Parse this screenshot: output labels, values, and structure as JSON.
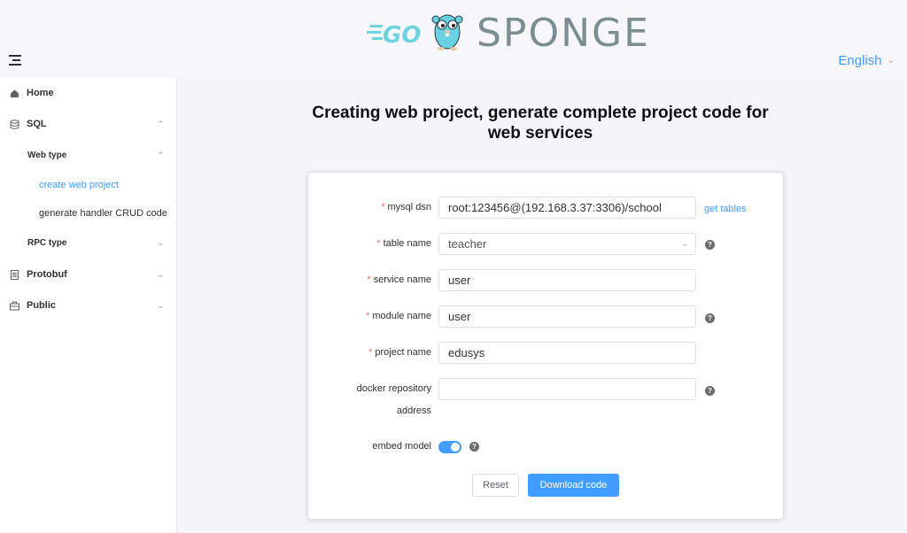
{
  "header": {
    "logo_go": "GO",
    "logo_word": "SPONGE",
    "language": "English"
  },
  "sidebar": {
    "home": "Home",
    "sql": "SQL",
    "web_type": "Web type",
    "create_web_project": "create web project",
    "generate_handler": "generate handler CRUD code",
    "rpc_type": "RPC type",
    "protobuf": "Protobuf",
    "public": "Public"
  },
  "page": {
    "title": "Creating web project, generate complete project code for web services"
  },
  "form": {
    "mysql_dsn_label": "mysql dsn",
    "mysql_dsn_value": "root:123456@(192.168.3.37:3306)/school",
    "get_tables": "get tables",
    "table_name_label": "table name",
    "table_name_value": "teacher",
    "service_name_label": "service name",
    "service_name_value": "user",
    "module_name_label": "module name",
    "module_name_value": "user",
    "project_name_label": "project name",
    "project_name_value": "edusys",
    "docker_label_line1": "docker repository",
    "docker_label_line2": "address",
    "docker_value": "",
    "embed_label": "embed model",
    "embed_on": true,
    "reset": "Reset",
    "download": "Download code"
  },
  "colors": {
    "accent": "#409eff",
    "required": "#f56c6c"
  }
}
